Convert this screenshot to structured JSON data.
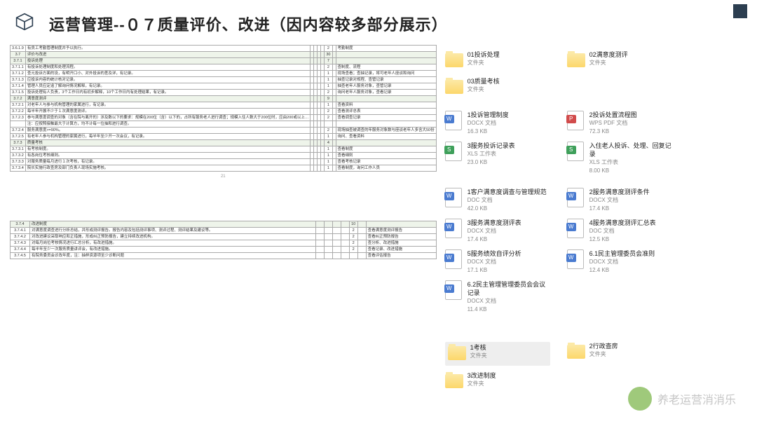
{
  "header": {
    "title": "运营管理--０７质量评价、改进（因内容较多部分展示）"
  },
  "table1": [
    {
      "n": "3.6.1.9",
      "t": "有员工考勤管理制度并予以执行。",
      "s": "2",
      "c": "考勤制度",
      "shade": false
    },
    {
      "n": "3.7",
      "t": "评价与改进",
      "s": "30",
      "c": "",
      "shade": true
    },
    {
      "n": "3.7.1",
      "t": "投诉处理",
      "s": "7",
      "c": "",
      "shade": true
    },
    {
      "n": "3.7.1.1",
      "t": "有投诉处理制度和处理流程。",
      "s": "2",
      "c": "查制度、流程",
      "shade": false
    },
    {
      "n": "3.7.1.2",
      "t": "查元投诉方面的设，有明开口小、对外投诉的差及详，有记录。",
      "s": "1",
      "c": "现场查看；查抽记录，将可老年人座谈和询问",
      "shade": false
    },
    {
      "n": "3.7.1.3",
      "t": "应投诉内容的统计核对记录。",
      "s": "1",
      "c": "抽查记录对规程、查管记录",
      "shade": false
    },
    {
      "n": "3.7.1.4",
      "t": "管理人员应定追了解询问情况解释，有记录。",
      "s": "1",
      "c": "抽查老年人服务对象，查管记录",
      "shade": false
    },
    {
      "n": "3.7.1.5",
      "t": "投诉处理有人负责，3个工作日内有初步解释，10个工作日内有处理结果，有记录。",
      "s": "2",
      "c": "询问老年人服务对象，查看记录",
      "shade": false
    },
    {
      "n": "3.7.2",
      "t": "满意度测评",
      "s": "9",
      "c": "",
      "shade": true
    },
    {
      "n": "3.7.2.1",
      "t": "对老年人与参与机构管理的家属进行，有记录。",
      "s": "1",
      "c": "查看资料",
      "shade": false
    },
    {
      "n": "3.7.2.2",
      "t": "每半年开展不少于１次满意度测评。",
      "s": "2",
      "c": "查看测评总表",
      "shade": false
    },
    {
      "n": "3.7.2.3",
      "t": "参与满意度调查的对象（含在院与离开的）涉及数以下的要求：规模在200位（含）以下的，占所有服务老人进行调查；规模入住人数大于200位时，应由200或以上…",
      "s": "2",
      "c": "查看调查记录",
      "shade": false
    },
    {
      "n": "",
      "t": "注：应按照接触最大于计算方，均不计每一位抽和进行调查。",
      "s": "",
      "c": "",
      "shade": false
    },
    {
      "n": "3.7.2.4",
      "t": "服务满意度>=90%。",
      "s": "2",
      "c": "现场抽查被调查的年服务对象数与座谈老年人多含大50份",
      "shade": false
    },
    {
      "n": "3.7.2.5",
      "t": "有老年人参与机构管理的家属进行，每半年至少开一次会议，有记录。",
      "s": "1",
      "c": "询问、查看资料",
      "shade": false
    },
    {
      "n": "3.7.3",
      "t": "质量考核",
      "s": "4",
      "c": "",
      "shade": true
    },
    {
      "n": "3.7.3.1",
      "t": "有考核制度。",
      "s": "1",
      "c": "查看制度",
      "shade": false
    },
    {
      "n": "3.7.3.2",
      "t": "有各岗位考核细则。",
      "s": "1",
      "c": "查看细则",
      "shade": false
    },
    {
      "n": "3.7.3.3",
      "t": "对服务质量每月进行１次考核，有记录。",
      "s": "1",
      "c": "查看考核记录",
      "shade": false
    },
    {
      "n": "3.7.3.4",
      "t": "院长实施行政查房及部门负责人现场实施考核。",
      "s": "1",
      "c": "查看制度，询问工作人员",
      "shade": false
    }
  ],
  "pagenum": "21",
  "table2": [
    {
      "n": "3.7.4",
      "t": "改进制度",
      "s": "10",
      "c": "",
      "shade": true
    },
    {
      "n": "3.7.4.1",
      "t": "对满意度调查进行分析总结，并形成测评报告。报告内容及包括测评事项、测评过程、测评结果及建议等。",
      "s": "2",
      "c": "查看满意度测评报告",
      "shade": false
    },
    {
      "n": "3.7.4.2",
      "t": "对改进建议采取响应和正措施，形成纠正预防报告，建立持续改进机构。",
      "s": "2",
      "c": "查看纠正预防报告",
      "shade": false
    },
    {
      "n": "3.7.4.3",
      "t": "对每月岗位考核情况进行汇总分析，有改进措施。",
      "s": "2",
      "c": "查分析、改进措施",
      "shade": false
    },
    {
      "n": "3.7.4.4",
      "t": "每半年至少一次服务质量讲评会，有改进措施。",
      "s": "2",
      "c": "查看记录、改进措施",
      "shade": false
    },
    {
      "n": "3.7.4.5",
      "t": "有院务委员会诊改年度，注：抽样资源项至少诊断问题",
      "s": "",
      "c": "查看评估报告",
      "shade": false
    }
  ],
  "folders1": [
    {
      "name": "01投诉处理",
      "type": "文件夹"
    },
    {
      "name": "02满意度测评",
      "type": "文件夹"
    },
    {
      "name": "03质量考核",
      "type": "文件夹"
    }
  ],
  "docs1": [
    {
      "name": "1投诉管理制度",
      "type": "DOCX 文档",
      "size": "16.3 KB",
      "tag": "W"
    },
    {
      "name": "2投诉处置流程图",
      "type": "WPS PDF 文档",
      "size": "72.3 KB",
      "tag": "P"
    },
    {
      "name": "3服务投诉记录表",
      "type": "XLS 工作表",
      "size": "23.0 KB",
      "tag": "S"
    },
    {
      "name": "入住老人投诉、处理、回复记录",
      "type": "XLS 工作表",
      "size": "8.00 KB",
      "tag": "S"
    }
  ],
  "docs2": [
    {
      "name": "1客户满意度调查与管理规范",
      "type": "DOC 文档",
      "size": "42.0 KB",
      "tag": "W"
    },
    {
      "name": "2服务满意度测评条件",
      "type": "DOCX 文档",
      "size": "17.4 KB",
      "tag": "W"
    },
    {
      "name": "3服务满意度测评表",
      "type": "DOCX 文档",
      "size": "17.4 KB",
      "tag": "W"
    },
    {
      "name": "4服务满意度测评汇总表",
      "type": "DOC 文档",
      "size": "12.5 KB",
      "tag": "W"
    },
    {
      "name": "5服务绩效自评分析",
      "type": "DOCX 文档",
      "size": "17.1 KB",
      "tag": "W"
    },
    {
      "name": "6.1民主管理委员会准则",
      "type": "DOCX 文档",
      "size": "12.4 KB",
      "tag": "W"
    },
    {
      "name": "6.2民主管理管理委员会会议记录",
      "type": "DOCX 文档",
      "size": "11.4 KB",
      "tag": "W"
    }
  ],
  "folders2": [
    {
      "name": "1考核",
      "type": "文件夹",
      "sel": true
    },
    {
      "name": "2行政查房",
      "type": "文件夹"
    },
    {
      "name": "3改进制度",
      "type": "文件夹"
    }
  ],
  "watermark": "养老运营消消乐"
}
